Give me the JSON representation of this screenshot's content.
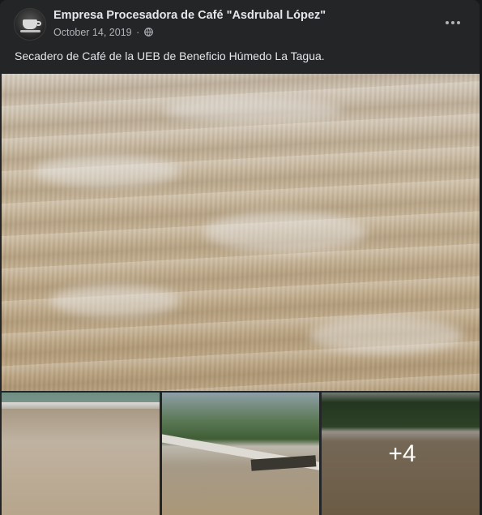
{
  "post": {
    "page_name": "Empresa Procesadora de Café \"Asdrubal López\"",
    "date": "October 14, 2019",
    "separator": "·",
    "privacy_icon": "globe-icon",
    "more_icon": "more-options-icon",
    "caption": "Secadero de Café de la UEB de Beneficio Húmedo La Tagua."
  },
  "gallery": {
    "main_photo": "coffee-beans-drying-bed-photo",
    "thumbnails": [
      {
        "photo": "drying-patio-photo"
      },
      {
        "photo": "drying-patio-with-wall-photo"
      },
      {
        "photo": "drying-patio-forest-photo",
        "overlay_label": "+4"
      }
    ]
  },
  "colors": {
    "card_background": "#242526",
    "primary_text": "#e4e6eb",
    "secondary_text": "#b0b3b8"
  }
}
